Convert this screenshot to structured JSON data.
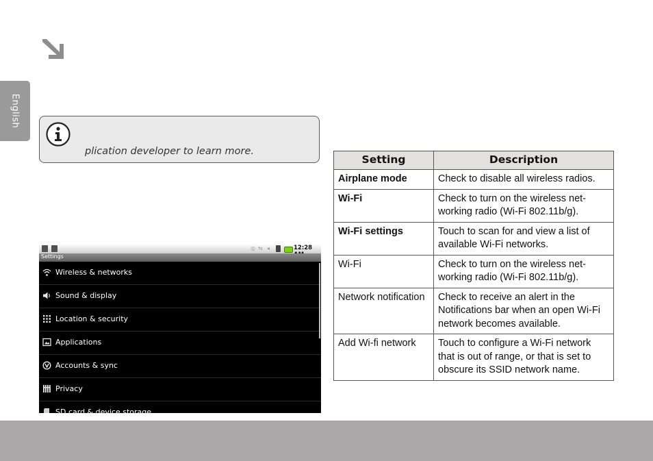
{
  "sidebar": {
    "language": "English"
  },
  "note": {
    "icon": "info-icon",
    "text": "plication developer to learn more."
  },
  "device": {
    "status_time": "12:28 AM",
    "screen_title": "Settings",
    "menu": [
      {
        "icon": "wifi-icon",
        "label": "Wireless & networks"
      },
      {
        "icon": "speaker-icon",
        "label": "Sound & display"
      },
      {
        "icon": "grid-icon",
        "label": "Location & security"
      },
      {
        "icon": "apps-icon",
        "label": "Applications"
      },
      {
        "icon": "sync-icon",
        "label": "Accounts & sync"
      },
      {
        "icon": "privacy-icon",
        "label": "Privacy"
      },
      {
        "icon": "sdcard-icon",
        "label": "SD card & device storage"
      }
    ]
  },
  "table": {
    "headers": [
      "Setting",
      "Description"
    ],
    "rows": [
      {
        "setting": "Airplane mode",
        "description": "Check to disable all wireless radios."
      },
      {
        "setting": "Wi-Fi",
        "description": "Check to turn on the wireless net-working radio (Wi-Fi 802.11b/g)."
      },
      {
        "setting": "Wi-Fi settings",
        "description": "Touch to scan for and view a list of available Wi-Fi networks."
      },
      {
        "setting": "Wi-Fi",
        "description": "Check to turn on the wireless net-working radio (Wi-Fi 802.11b/g)."
      },
      {
        "setting": "Network notification",
        "description": "Check to receive an alert in the Notifications bar when an open Wi-Fi network becomes available."
      },
      {
        "setting": "Add Wi-fi network",
        "description": "Touch to configure a Wi-Fi network that is out of range, or that is set to obscure its SSID network name."
      }
    ]
  },
  "colors": {
    "footer": "#a9a7a7",
    "tab": "#9a9a9a",
    "table_header": "#e3e0de",
    "battery": "#7bd218"
  }
}
